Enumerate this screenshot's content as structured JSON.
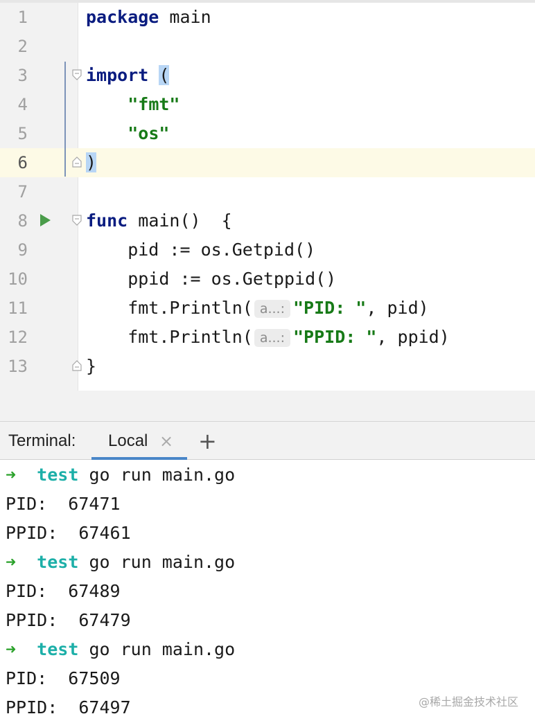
{
  "editor": {
    "lines": [
      {
        "n": "1",
        "segments": [
          {
            "t": "package",
            "c": "kw"
          },
          {
            "t": " main",
            "c": ""
          }
        ]
      },
      {
        "n": "2",
        "segments": []
      },
      {
        "n": "3",
        "segments": [
          {
            "t": "import",
            "c": "kw"
          },
          {
            "t": " ",
            "c": ""
          },
          {
            "t": "(",
            "c": "paren-hl"
          }
        ]
      },
      {
        "n": "4",
        "segments": [
          {
            "t": "    ",
            "c": ""
          },
          {
            "t": "\"fmt\"",
            "c": "str"
          }
        ]
      },
      {
        "n": "5",
        "segments": [
          {
            "t": "    ",
            "c": ""
          },
          {
            "t": "\"os\"",
            "c": "str"
          }
        ]
      },
      {
        "n": "6",
        "segments": [
          {
            "t": ")",
            "c": "paren-hl"
          }
        ]
      },
      {
        "n": "7",
        "segments": []
      },
      {
        "n": "8",
        "segments": [
          {
            "t": "func",
            "c": "kw"
          },
          {
            "t": " main()  {",
            "c": ""
          }
        ]
      },
      {
        "n": "9",
        "segments": [
          {
            "t": "    pid := os.Getpid()",
            "c": ""
          }
        ]
      },
      {
        "n": "10",
        "segments": [
          {
            "t": "    ppid := os.Getppid()",
            "c": ""
          }
        ]
      },
      {
        "n": "11",
        "segments": [
          {
            "t": "    fmt.Println(",
            "c": ""
          },
          {
            "t": "a...:",
            "c": "hint"
          },
          {
            "t": "\"PID: \"",
            "c": "str"
          },
          {
            "t": ", pid)",
            "c": ""
          }
        ]
      },
      {
        "n": "12",
        "segments": [
          {
            "t": "    fmt.Println(",
            "c": ""
          },
          {
            "t": "a...:",
            "c": "hint"
          },
          {
            "t": "\"PPID: \"",
            "c": "str"
          },
          {
            "t": ", ppid)",
            "c": ""
          }
        ]
      },
      {
        "n": "13",
        "segments": [
          {
            "t": "}",
            "c": ""
          }
        ]
      }
    ],
    "current_line": "6"
  },
  "terminal": {
    "title": "Terminal:",
    "tab_label": "Local",
    "close_symbol": "×",
    "add_symbol": "+",
    "lines": [
      {
        "type": "prompt",
        "arrow": "➜",
        "dir": "test",
        "cmd": " go run main.go"
      },
      {
        "type": "out",
        "text": "PID:  67471"
      },
      {
        "type": "out",
        "text": "PPID:  67461"
      },
      {
        "type": "prompt",
        "arrow": "➜",
        "dir": "test",
        "cmd": " go run main.go"
      },
      {
        "type": "out",
        "text": "PID:  67489"
      },
      {
        "type": "out",
        "text": "PPID:  67479"
      },
      {
        "type": "prompt",
        "arrow": "➜",
        "dir": "test",
        "cmd": " go run main.go"
      },
      {
        "type": "out",
        "text": "PID:  67509"
      },
      {
        "type": "out",
        "text": "PPID:  67497"
      }
    ]
  },
  "watermark": "@稀土掘金技术社区"
}
